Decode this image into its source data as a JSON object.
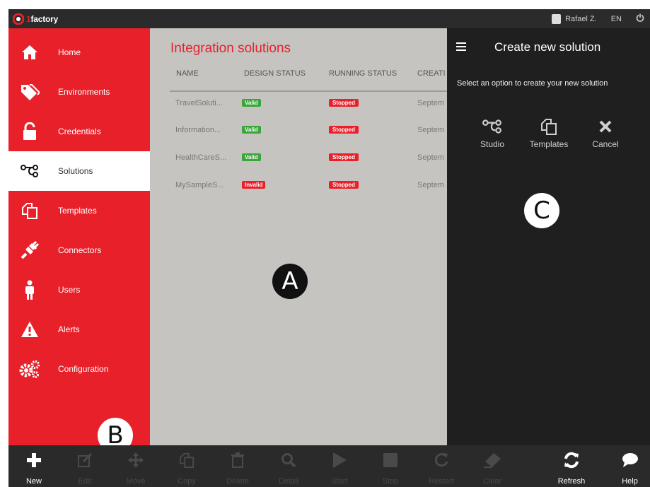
{
  "topbar": {
    "logo_prefix": "1",
    "logo_text": "factory",
    "user_name": "Rafael Z.",
    "language": "EN"
  },
  "sidebar": {
    "items": [
      {
        "label": "Home",
        "icon": "home-icon"
      },
      {
        "label": "Environments",
        "icon": "tags-icon"
      },
      {
        "label": "Credentials",
        "icon": "unlock-icon"
      },
      {
        "label": "Solutions",
        "icon": "solutions-icon",
        "active": true
      },
      {
        "label": "Templates",
        "icon": "copy-icon"
      },
      {
        "label": "Connectors",
        "icon": "plug-icon"
      },
      {
        "label": "Users",
        "icon": "user-icon"
      },
      {
        "label": "Alerts",
        "icon": "warning-icon"
      },
      {
        "label": "Configuration",
        "icon": "gears-icon"
      }
    ]
  },
  "main": {
    "title": "Integration solutions",
    "columns": [
      "NAME",
      "DESIGN STATUS",
      "RUNNING STATUS",
      "CREATI"
    ],
    "rows": [
      {
        "name": "TravelSoluti...",
        "design_status": "Valid",
        "running_status": "Stopped",
        "created": "Septem"
      },
      {
        "name": "Information...",
        "design_status": "Valid",
        "running_status": "Stopped",
        "created": "Septem"
      },
      {
        "name": "HealthCareS...",
        "design_status": "Valid",
        "running_status": "Stopped",
        "created": "Septem"
      },
      {
        "name": "MySampleS...",
        "design_status": "Invalid",
        "running_status": "Stopped",
        "created": "Septem"
      }
    ]
  },
  "panel": {
    "title": "Create new solution",
    "subtitle": "Select an option to create your new solution",
    "options": [
      {
        "label": "Studio",
        "icon": "studio-icon"
      },
      {
        "label": "Templates",
        "icon": "copy-icon"
      },
      {
        "label": "Cancel",
        "icon": "close-icon"
      }
    ]
  },
  "markers": {
    "a": "A",
    "b": "B",
    "c": "C"
  },
  "toolbar": {
    "buttons": [
      {
        "label": "New",
        "icon": "plus-icon",
        "enabled": true
      },
      {
        "label": "Edit",
        "icon": "edit-icon",
        "enabled": false
      },
      {
        "label": "Move",
        "icon": "move-icon",
        "enabled": false
      },
      {
        "label": "Copy",
        "icon": "copy-icon",
        "enabled": false
      },
      {
        "label": "Delete",
        "icon": "trash-icon",
        "enabled": false
      },
      {
        "label": "Detail",
        "icon": "search-icon",
        "enabled": false
      },
      {
        "label": "Start",
        "icon": "play-icon",
        "enabled": false
      },
      {
        "label": "Stop",
        "icon": "stop-icon",
        "enabled": false
      },
      {
        "label": "Restart",
        "icon": "restart-icon",
        "enabled": false
      },
      {
        "label": "Clear",
        "icon": "eraser-icon",
        "enabled": false
      },
      {
        "label": "Refresh",
        "icon": "refresh-icon",
        "enabled": true
      },
      {
        "label": "Help",
        "icon": "help-icon",
        "enabled": true
      }
    ]
  },
  "colors": {
    "brand_red": "#e8202a",
    "topbar": "#2b2b2b",
    "panel": "#1f1f1f",
    "main_bg": "#c6c4c1",
    "valid_green": "#3aa63a"
  }
}
